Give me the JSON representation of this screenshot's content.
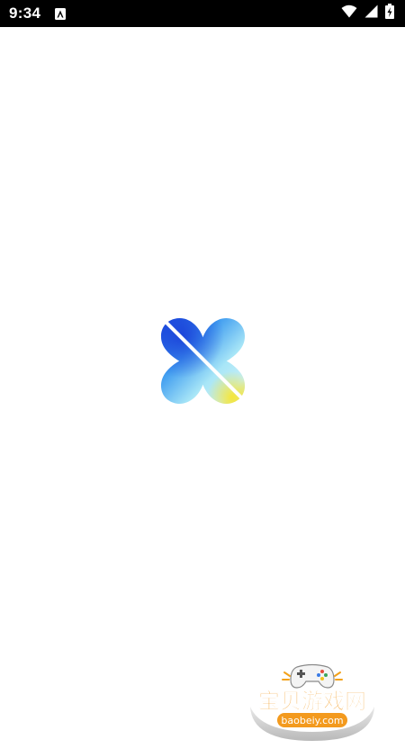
{
  "status_bar": {
    "time": "9:34",
    "icons": [
      "android-auto-notification-icon",
      "wifi-icon",
      "cell-signal-icon",
      "battery-charging-icon"
    ]
  },
  "splash": {
    "logo_icon": "app-logo-icon",
    "watermark": {
      "brand": "宝贝游戏网",
      "url": "baobeiy.com"
    }
  },
  "colors": {
    "status_bar_bg": "#000000",
    "background": "#ffffff",
    "logo_blue": "#1a5de6",
    "logo_cyan": "#9fe3f5",
    "logo_yellow": "#f3e24a",
    "watermark_orange": "#f39a1e"
  }
}
